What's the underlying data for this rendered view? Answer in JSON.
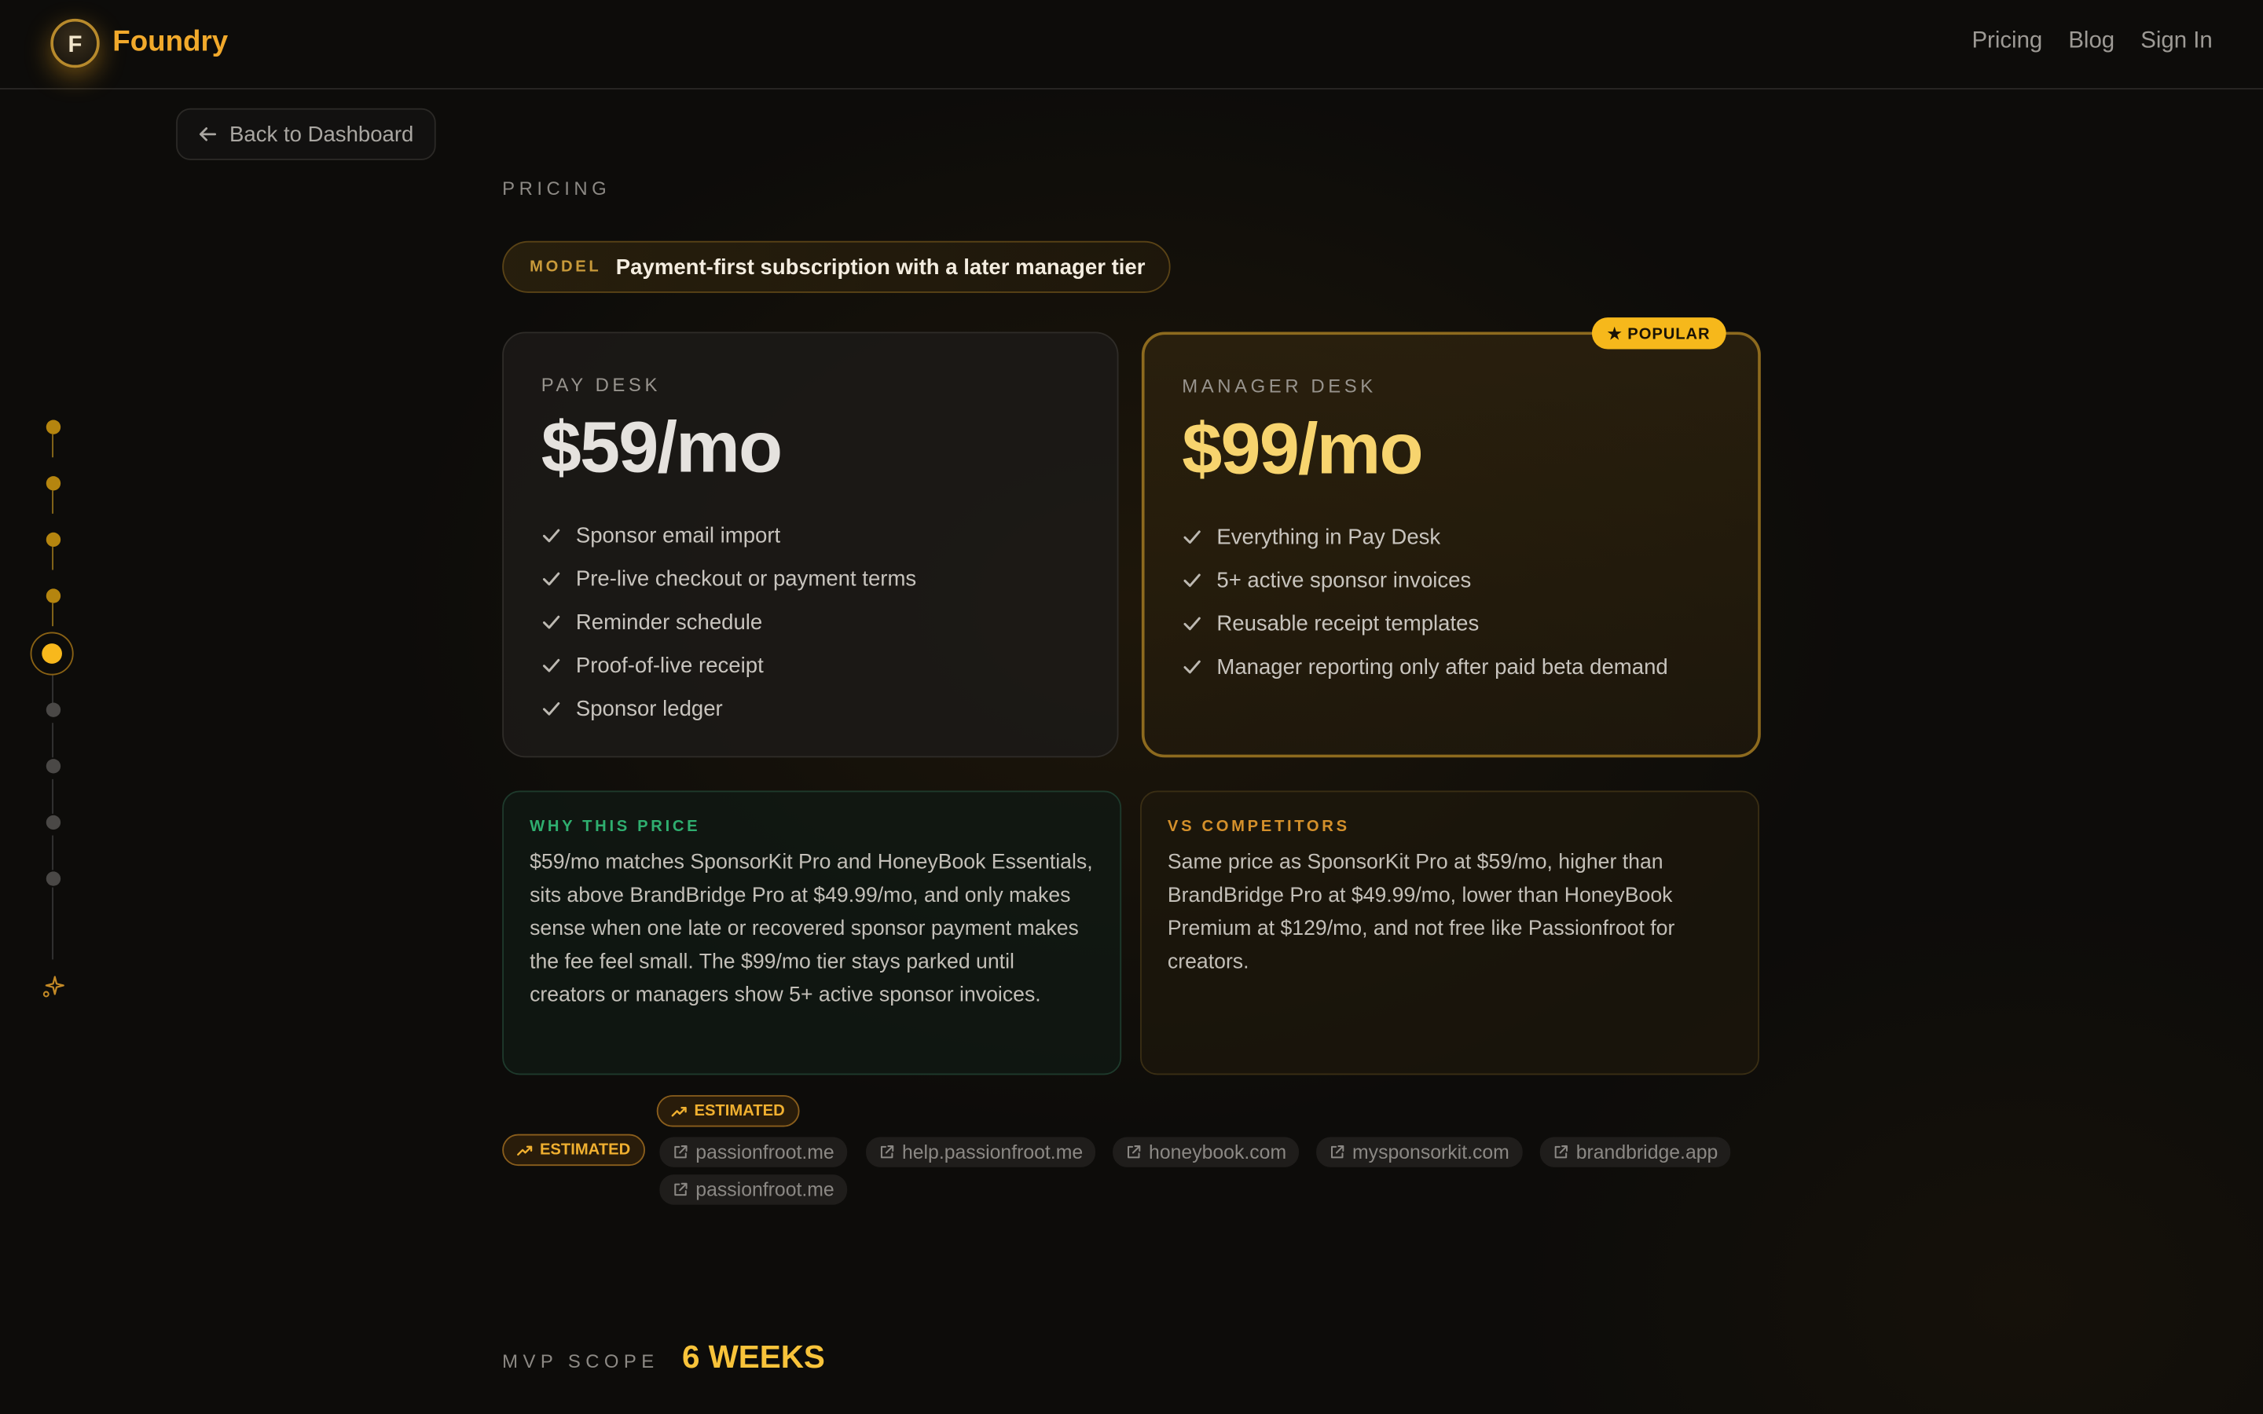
{
  "header": {
    "logo_letter": "F",
    "brand": "Foundry",
    "nav": [
      "Pricing",
      "Blog",
      "Sign In"
    ]
  },
  "back_button": "Back to Dashboard",
  "section_label": "PRICING",
  "model": {
    "label": "MODEL",
    "text": "Payment-first subscription with a later manager tier"
  },
  "plans": [
    {
      "name": "PAY DESK",
      "price": "$59/mo",
      "features": [
        "Sponsor email import",
        "Pre-live checkout or payment terms",
        "Reminder schedule",
        "Proof-of-live receipt",
        "Sponsor ledger"
      ]
    },
    {
      "name": "MANAGER DESK",
      "price": "$99/mo",
      "badge": "★ POPULAR",
      "features": [
        "Everything in Pay Desk",
        "5+ active sponsor invoices",
        "Reusable receipt templates",
        "Manager reporting only after paid beta demand"
      ]
    }
  ],
  "why": {
    "title": "WHY THIS PRICE",
    "body": "$59/mo matches SponsorKit Pro and HoneyBook Essentials, sits above BrandBridge Pro at $49.99/mo, and only makes sense when one late or recovered sponsor payment makes the fee feel small. The $99/mo tier stays parked until creators or managers show 5+ active sponsor invoices."
  },
  "vs": {
    "title": "VS COMPETITORS",
    "body": "Same price as SponsorKit Pro at $59/mo, higher than BrandBridge Pro at $49.99/mo, lower than HoneyBook Premium at $129/mo, and not free like Passionfroot for creators."
  },
  "estimated_label": "ESTIMATED",
  "sources": [
    "passionfroot.me",
    "help.passionfroot.me",
    "honeybook.com",
    "mysponsorkit.com",
    "brandbridge.app",
    "passionfroot.me"
  ],
  "mvp": {
    "label": "MVP SCOPE",
    "value": "6 WEEKS"
  },
  "colors": {
    "accent": "#f6b81b",
    "brand": "#f1a92b",
    "why_title": "#2fae6f",
    "vs_title": "#d4902b"
  },
  "timeline": {
    "steps": 9,
    "current_step": 5
  }
}
